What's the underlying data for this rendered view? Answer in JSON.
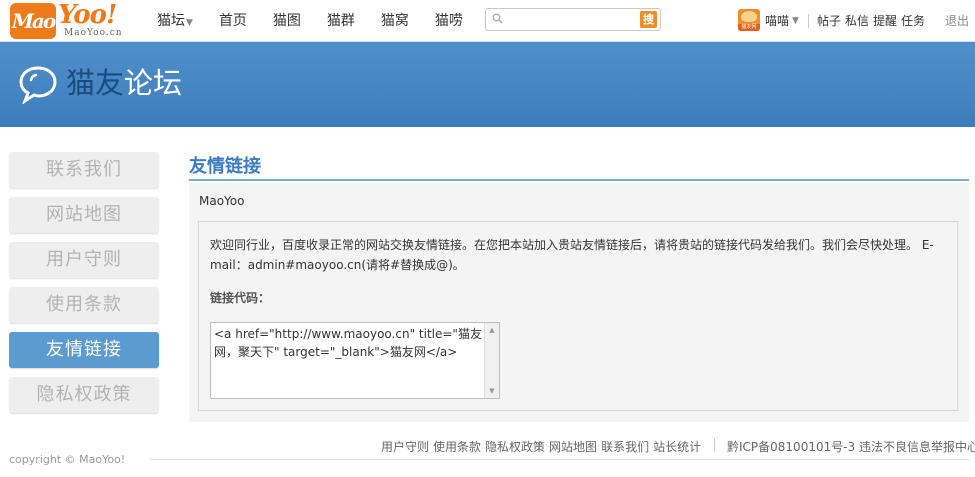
{
  "logo": {
    "badge": "Mao",
    "word": "Yoo!",
    "sub": "MaoYoo.cn"
  },
  "nav": {
    "items": [
      {
        "label": "猫坛",
        "has_dropdown": true
      },
      {
        "label": "首页"
      },
      {
        "label": "猫图"
      },
      {
        "label": "猫群"
      },
      {
        "label": "猫窝"
      },
      {
        "label": "猫唠"
      }
    ]
  },
  "search": {
    "placeholder": "",
    "button_label": "搜"
  },
  "user": {
    "avatar_label": "猫友网",
    "name": "喵喵",
    "caret": "▼",
    "links": [
      "帖子",
      "私信",
      "提醒",
      "任务"
    ],
    "logout": "退出"
  },
  "banner": {
    "title_part1": "猫友",
    "title_part2": "论坛"
  },
  "sidebar": {
    "items": [
      {
        "label": "联系我们",
        "active": false
      },
      {
        "label": "网站地图",
        "active": false
      },
      {
        "label": "用户守则",
        "active": false
      },
      {
        "label": "使用条款",
        "active": false
      },
      {
        "label": "友情链接",
        "active": true
      },
      {
        "label": "隐私权政策",
        "active": false
      }
    ]
  },
  "main": {
    "title": "友情链接",
    "site_name": "MaoYoo",
    "intro": "欢迎同行业，百度收录正常的网站交换友情链接。在您把本站加入贵站友情链接后，请将贵站的链接代码发给我们。我们会尽快处理。 E-mail：admin#maoyoo.cn(请将#替换成@)。",
    "code_label": "链接代码：",
    "code_value": "<a href=\"http://www.maoyoo.cn\" title=\"猫友网，聚天下\" target=\"_blank\">猫友网</a>"
  },
  "footer": {
    "links": [
      "用户守则",
      "使用条款",
      "隐私权政策",
      "网站地图",
      "联系我们",
      "站长统计"
    ],
    "icp": "黔ICP备08100101号-3 违法不良信息举报中心",
    "copyright": "copyright © MaoYoo!"
  },
  "colors": {
    "brand_orange": "#ee7a1a",
    "banner_blue": "#4a8ac7",
    "accent_blue": "#3c7cbf",
    "active_tab": "#5b9bd0"
  }
}
